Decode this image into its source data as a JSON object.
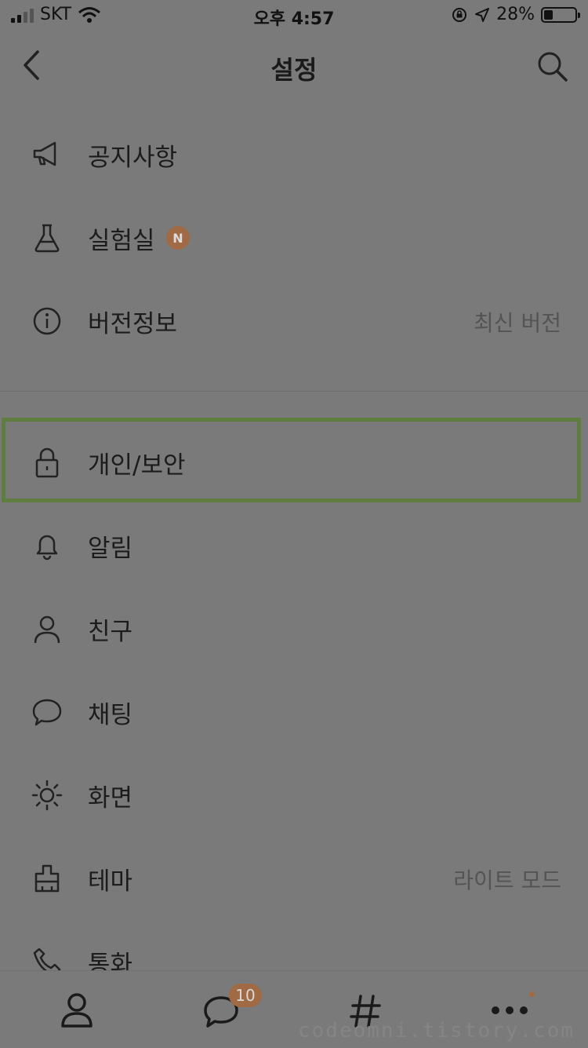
{
  "status": {
    "carrier": "SKT",
    "time": "오후 4:57",
    "battery_percent": "28%",
    "battery_level": 0.28
  },
  "header": {
    "title": "설정",
    "back_icon": "chevron-left-icon",
    "search_icon": "search-icon"
  },
  "menu": {
    "items": [
      {
        "label": "공지사항",
        "icon": "megaphone-icon"
      },
      {
        "label": "실험실",
        "icon": "flask-icon",
        "badge": "N"
      },
      {
        "label": "버전정보",
        "icon": "info-icon",
        "value": "최신 버전"
      },
      {
        "label": "개인/보안",
        "icon": "lock-icon"
      },
      {
        "label": "알림",
        "icon": "bell-icon"
      },
      {
        "label": "친구",
        "icon": "person-icon"
      },
      {
        "label": "채팅",
        "icon": "chat-bubble-icon"
      },
      {
        "label": "화면",
        "icon": "brightness-icon"
      },
      {
        "label": "테마",
        "icon": "brush-icon",
        "value": "라이트 모드"
      },
      {
        "label": "통화",
        "icon": "phone-icon"
      }
    ]
  },
  "tabbar": {
    "tabs": [
      {
        "icon": "friends-icon"
      },
      {
        "icon": "chats-icon",
        "badge": "10"
      },
      {
        "icon": "hashtag-icon"
      },
      {
        "icon": "more-icon"
      }
    ]
  },
  "watermark": "codeomni.tistory.com",
  "colors": {
    "background": "#7a7a7a",
    "accent": "#a06a45",
    "highlight": "#5e7d3e"
  }
}
